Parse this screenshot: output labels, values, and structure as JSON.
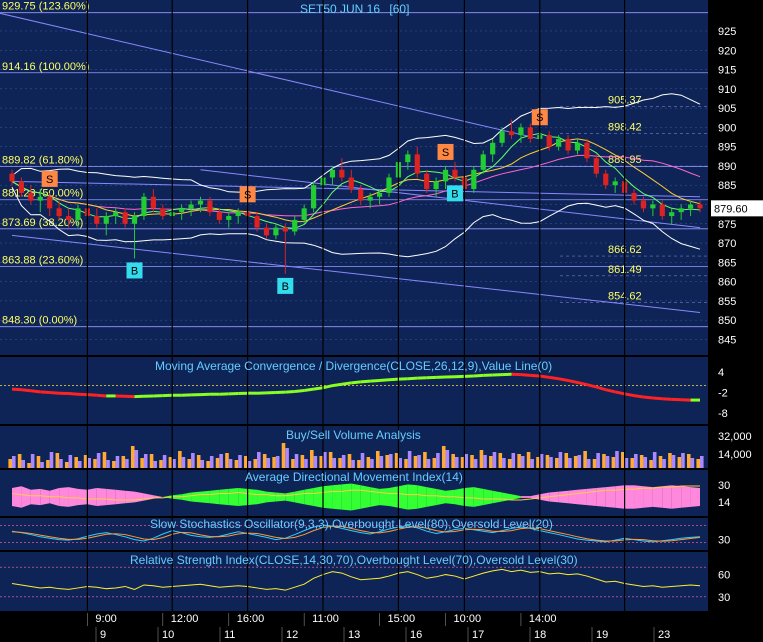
{
  "chart_title": "SET50 JUN 16",
  "chart_period": "[60]",
  "colors": {
    "bg": "#0f2456",
    "bg2": "#0b1d46",
    "frame": "#000000",
    "grid": "#3a5a9a",
    "text": "#ffffff",
    "fib_text": "#ffff66",
    "title_text": "#66ccff",
    "up": "#22cc33",
    "down": "#dd2222",
    "trend": "#8888ff",
    "sell": "#ff8844",
    "buy": "#33ddee"
  },
  "chart_data": [
    {
      "type": "candlestick",
      "title": "SET50 JUN 16 [60]",
      "y_ticks": [
        925,
        920,
        915,
        910,
        905,
        900,
        895,
        890,
        885,
        880,
        875,
        870,
        865,
        860,
        855,
        850,
        845
      ],
      "ylim": [
        842,
        932
      ],
      "last_price": "879.60",
      "fib_levels": [
        {
          "label": "929.75 (123.60%)",
          "value": 929.75
        },
        {
          "label": "914.16 (100.00%)",
          "value": 914.16
        },
        {
          "label": "889.82 (61.80%)",
          "value": 889.82
        },
        {
          "label": "881.23 (50.00%)",
          "value": 881.23
        },
        {
          "label": "873.69 (38.20%)",
          "value": 873.69
        },
        {
          "label": "863.88 (23.60%)",
          "value": 863.88
        },
        {
          "label": "848.30 (0.00%)",
          "value": 848.3
        }
      ],
      "price_labels": [
        {
          "label": "905.37",
          "value": 905.37
        },
        {
          "label": "898.42",
          "value": 898.42
        },
        {
          "label": "889.95",
          "value": 889.95
        },
        {
          "label": "866.62",
          "value": 866.62
        },
        {
          "label": "861.49",
          "value": 861.49
        },
        {
          "label": "854.62",
          "value": 854.62
        }
      ],
      "candles": [
        [
          888,
          889,
          885,
          886
        ],
        [
          886,
          887,
          882,
          883
        ],
        [
          883,
          885,
          880,
          881
        ],
        [
          881,
          884,
          878,
          882
        ],
        [
          882,
          883,
          877,
          879
        ],
        [
          879,
          881,
          876,
          877
        ],
        [
          877,
          879,
          874,
          876
        ],
        [
          876,
          880,
          874,
          879
        ],
        [
          879,
          880,
          876,
          877
        ],
        [
          877,
          879,
          874,
          875
        ],
        [
          875,
          878,
          872,
          877
        ],
        [
          877,
          879,
          875,
          878
        ],
        [
          878,
          879,
          874,
          875
        ],
        [
          875,
          878,
          866,
          877
        ],
        [
          877,
          883,
          876,
          882
        ],
        [
          882,
          884,
          878,
          879
        ],
        [
          879,
          880,
          876,
          877
        ],
        [
          877,
          879,
          875,
          878
        ],
        [
          878,
          880,
          876,
          879
        ],
        [
          879,
          881,
          877,
          880
        ],
        [
          880,
          882,
          878,
          881
        ],
        [
          881,
          882,
          877,
          878
        ],
        [
          878,
          879,
          875,
          876
        ],
        [
          876,
          878,
          874,
          877
        ],
        [
          877,
          879,
          875,
          878
        ],
        [
          878,
          879,
          876,
          877
        ],
        [
          877,
          878,
          873,
          874
        ],
        [
          874,
          875,
          871,
          872
        ],
        [
          872,
          875,
          871,
          874
        ],
        [
          874,
          875,
          862,
          873
        ],
        [
          873,
          877,
          872,
          876
        ],
        [
          876,
          880,
          875,
          879
        ],
        [
          879,
          886,
          878,
          885
        ],
        [
          885,
          888,
          883,
          887
        ],
        [
          887,
          890,
          885,
          889
        ],
        [
          889,
          892,
          886,
          887
        ],
        [
          887,
          889,
          883,
          884
        ],
        [
          884,
          885,
          880,
          881
        ],
        [
          881,
          883,
          879,
          882
        ],
        [
          882,
          884,
          880,
          883
        ],
        [
          883,
          888,
          882,
          887
        ],
        [
          887,
          892,
          886,
          891
        ],
        [
          891,
          894,
          889,
          893
        ],
        [
          893,
          895,
          887,
          888
        ],
        [
          888,
          889,
          883,
          884
        ],
        [
          884,
          887,
          882,
          886
        ],
        [
          886,
          890,
          884,
          889
        ],
        [
          889,
          891,
          886,
          887
        ],
        [
          887,
          889,
          880,
          884
        ],
        [
          884,
          890,
          883,
          889
        ],
        [
          889,
          894,
          888,
          893
        ],
        [
          893,
          897,
          891,
          896
        ],
        [
          896,
          900,
          895,
          899
        ],
        [
          899,
          902,
          897,
          898
        ],
        [
          898,
          901,
          896,
          900
        ],
        [
          900,
          901,
          896,
          897
        ],
        [
          897,
          899,
          895,
          898
        ],
        [
          898,
          899,
          894,
          895
        ],
        [
          895,
          898,
          894,
          897
        ],
        [
          897,
          898,
          893,
          894
        ],
        [
          894,
          897,
          893,
          896
        ],
        [
          896,
          897,
          891,
          892
        ],
        [
          892,
          893,
          887,
          888
        ],
        [
          888,
          889,
          884,
          885
        ],
        [
          885,
          887,
          883,
          886
        ],
        [
          886,
          887,
          882,
          883
        ],
        [
          883,
          884,
          880,
          881
        ],
        [
          881,
          882,
          878,
          879
        ],
        [
          879,
          881,
          877,
          880
        ],
        [
          880,
          881,
          876,
          877
        ],
        [
          877,
          879,
          875,
          878
        ],
        [
          878,
          880,
          876,
          879
        ],
        [
          879,
          881,
          877,
          880
        ],
        [
          880,
          881,
          878,
          879
        ]
      ],
      "signals": [
        {
          "type": "S",
          "index": 4
        },
        {
          "type": "B",
          "index": 13
        },
        {
          "type": "S",
          "index": 25
        },
        {
          "type": "B",
          "index": 29
        },
        {
          "type": "S",
          "index": 46
        },
        {
          "type": "B",
          "index": 47
        },
        {
          "type": "S",
          "index": 56
        }
      ]
    },
    {
      "type": "area",
      "title": "Moving Average Convergence / Divergence(CLOSE,26,12,9),Value Line(0)",
      "y_ticks": [
        "4",
        "-2",
        "-8"
      ],
      "ylim": [
        -10,
        6
      ],
      "values": [
        -1,
        -1.2,
        -1.5,
        -1.8,
        -2,
        -2.2,
        -2.3,
        -2.5,
        -2.6,
        -2.8,
        -3,
        -3,
        -3.1,
        -3.2,
        -3.1,
        -3,
        -2.9,
        -2.8,
        -2.8,
        -2.7,
        -2.6,
        -2.5,
        -2.5,
        -2.4,
        -2.3,
        -2.2,
        -2.2,
        -2.1,
        -2,
        -1.9,
        -1.7,
        -1.4,
        -1,
        -0.6,
        0,
        0.4,
        0.8,
        1.1,
        1.3,
        1.5,
        1.7,
        1.9,
        2,
        2.2,
        2.3,
        2.4,
        2.5,
        2.6,
        2.7,
        2.8,
        3,
        3.1,
        3.2,
        3.3,
        3.2,
        3,
        2.8,
        2.4,
        2,
        1.5,
        0.9,
        0.3,
        -0.4,
        -1.2,
        -1.8,
        -2.4,
        -2.9,
        -3.3,
        -3.6,
        -3.8,
        -4,
        -4.1,
        -4.2,
        -4.2
      ]
    },
    {
      "type": "bar",
      "title": "Buy/Sell Volume Analysis",
      "y_ticks": [
        "32,000",
        "14,000"
      ],
      "ylim": [
        0,
        40000
      ],
      "buy": [
        9000,
        14000,
        5000,
        12000,
        8000,
        15000,
        6000,
        11000,
        13000,
        9000,
        16000,
        7000,
        12000,
        22000,
        10000,
        14000,
        8000,
        11000,
        17000,
        9000,
        13000,
        7000,
        10000,
        15000,
        8000,
        12000,
        9000,
        14000,
        11000,
        25000,
        9000,
        13000,
        18000,
        12000,
        16000,
        10000,
        14000,
        8000,
        11000,
        17000,
        13000,
        15000,
        9000,
        12000,
        16000,
        10000,
        22000,
        14000,
        11000,
        13000,
        18000,
        12000,
        15000,
        9000,
        14000,
        16000,
        11000,
        13000,
        10000,
        15000,
        12000,
        17000,
        9000,
        14000,
        11000,
        16000,
        10000,
        13000,
        8000,
        12000,
        15000,
        11000,
        14000,
        9000
      ],
      "sell": [
        12000,
        8000,
        14000,
        6000,
        16000,
        9000,
        13000,
        7000,
        10000,
        15000,
        8000,
        12000,
        9000,
        18000,
        14000,
        7000,
        13000,
        9000,
        11000,
        15000,
        8000,
        12000,
        14000,
        9000,
        13000,
        7000,
        16000,
        10000,
        12000,
        20000,
        14000,
        9000,
        12000,
        16000,
        10000,
        13000,
        8000,
        15000,
        9000,
        12000,
        14000,
        10000,
        17000,
        13000,
        9000,
        15000,
        18000,
        11000,
        14000,
        9000,
        13000,
        16000,
        10000,
        15000,
        12000,
        9000,
        14000,
        11000,
        16000,
        10000,
        13000,
        9000,
        15000,
        12000,
        17000,
        10000,
        14000,
        11000,
        16000,
        9000,
        13000,
        15000,
        10000,
        12000
      ]
    },
    {
      "type": "area",
      "title": "Average Directional Movement Index(14)",
      "y_ticks": [
        "30",
        "14"
      ],
      "ylim": [
        5,
        40
      ],
      "di_diff": [
        10,
        12,
        8,
        9,
        7,
        10,
        11,
        9,
        8,
        10,
        9,
        8,
        7,
        6,
        4,
        2,
        0,
        -2,
        -3,
        -5,
        -6,
        -7,
        -8,
        -9,
        -10,
        -9,
        -8,
        -6,
        -5,
        -4,
        -6,
        -8,
        -10,
        -12,
        -13,
        -14,
        -15,
        -13,
        -11,
        -9,
        -10,
        -12,
        -14,
        -13,
        -11,
        -9,
        -7,
        -8,
        -10,
        -11,
        -9,
        -7,
        -5,
        -3,
        -1,
        1,
        3,
        5,
        6,
        7,
        8,
        9,
        10,
        11,
        12,
        13,
        13,
        12,
        11,
        12,
        13,
        12,
        11,
        10
      ],
      "adx": [
        22,
        21,
        20,
        20,
        19,
        19,
        18,
        18,
        17,
        17,
        17,
        16,
        16,
        16,
        17,
        18,
        18,
        19,
        19,
        20,
        21,
        21,
        22,
        22,
        23,
        22,
        21,
        21,
        20,
        20,
        21,
        22,
        22,
        23,
        24,
        24,
        25,
        25,
        24,
        23,
        22,
        22,
        21,
        21,
        20,
        20,
        19,
        19,
        18,
        18,
        17,
        17,
        17,
        16,
        16,
        17,
        18,
        19,
        20,
        21,
        22,
        23,
        24,
        25,
        25,
        26,
        26,
        27,
        27,
        28,
        28,
        29,
        29,
        29
      ]
    },
    {
      "type": "line",
      "title": "Slow Stochastics Oscillator(9,3,3),Overbought Level(80),Oversold Level(20)",
      "y_ticks": [
        "30"
      ],
      "ylim": [
        0,
        100
      ],
      "k": [
        60,
        55,
        48,
        40,
        35,
        30,
        28,
        33,
        42,
        50,
        55,
        48,
        40,
        30,
        25,
        35,
        50,
        62,
        55,
        45,
        40,
        38,
        42,
        50,
        58,
        52,
        45,
        38,
        30,
        35,
        48,
        62,
        75,
        82,
        78,
        70,
        62,
        55,
        50,
        58,
        68,
        75,
        80,
        72,
        60,
        52,
        58,
        66,
        70,
        65,
        60,
        55,
        62,
        70,
        75,
        70,
        62,
        55,
        48,
        40,
        32,
        28,
        25,
        22,
        28,
        35,
        30,
        25,
        22,
        26,
        30,
        35,
        38,
        40
      ],
      "d": [
        58,
        56,
        52,
        46,
        40,
        35,
        31,
        31,
        35,
        42,
        49,
        51,
        48,
        40,
        32,
        30,
        37,
        49,
        56,
        54,
        47,
        41,
        40,
        43,
        50,
        53,
        52,
        45,
        38,
        34,
        38,
        48,
        62,
        73,
        78,
        77,
        70,
        62,
        56,
        54,
        59,
        67,
        74,
        76,
        71,
        62,
        57,
        59,
        65,
        67,
        65,
        60,
        59,
        62,
        69,
        72,
        69,
        62,
        55,
        48,
        40,
        33,
        28,
        25,
        25,
        29,
        31,
        30,
        26,
        24,
        26,
        30,
        34,
        38
      ]
    },
    {
      "type": "line",
      "title": "Relative Strength Index(CLOSE,14,30,70),Overbought Level(70),Oversold Level(30)",
      "y_ticks": [
        "60",
        "30"
      ],
      "ylim": [
        15,
        85
      ],
      "values": [
        48,
        46,
        44,
        42,
        43,
        41,
        40,
        42,
        44,
        43,
        41,
        42,
        44,
        40,
        46,
        45,
        43,
        44,
        45,
        46,
        47,
        45,
        43,
        44,
        45,
        44,
        42,
        40,
        41,
        39,
        43,
        47,
        55,
        60,
        64,
        62,
        57,
        53,
        54,
        55,
        58,
        62,
        64,
        60,
        55,
        57,
        60,
        58,
        54,
        58,
        62,
        65,
        67,
        64,
        66,
        63,
        64,
        61,
        62,
        60,
        61,
        58,
        54,
        50,
        51,
        48,
        46,
        44,
        45,
        43,
        44,
        45,
        46,
        45
      ]
    }
  ],
  "time_labels": [
    "9:00",
    "12:00",
    "16:00",
    "11:00",
    "15:00",
    "10:00",
    "14:00"
  ],
  "date_labels": [
    "9",
    "10",
    "11",
    "12",
    "13",
    "16",
    "17",
    "18",
    "19",
    "23"
  ]
}
